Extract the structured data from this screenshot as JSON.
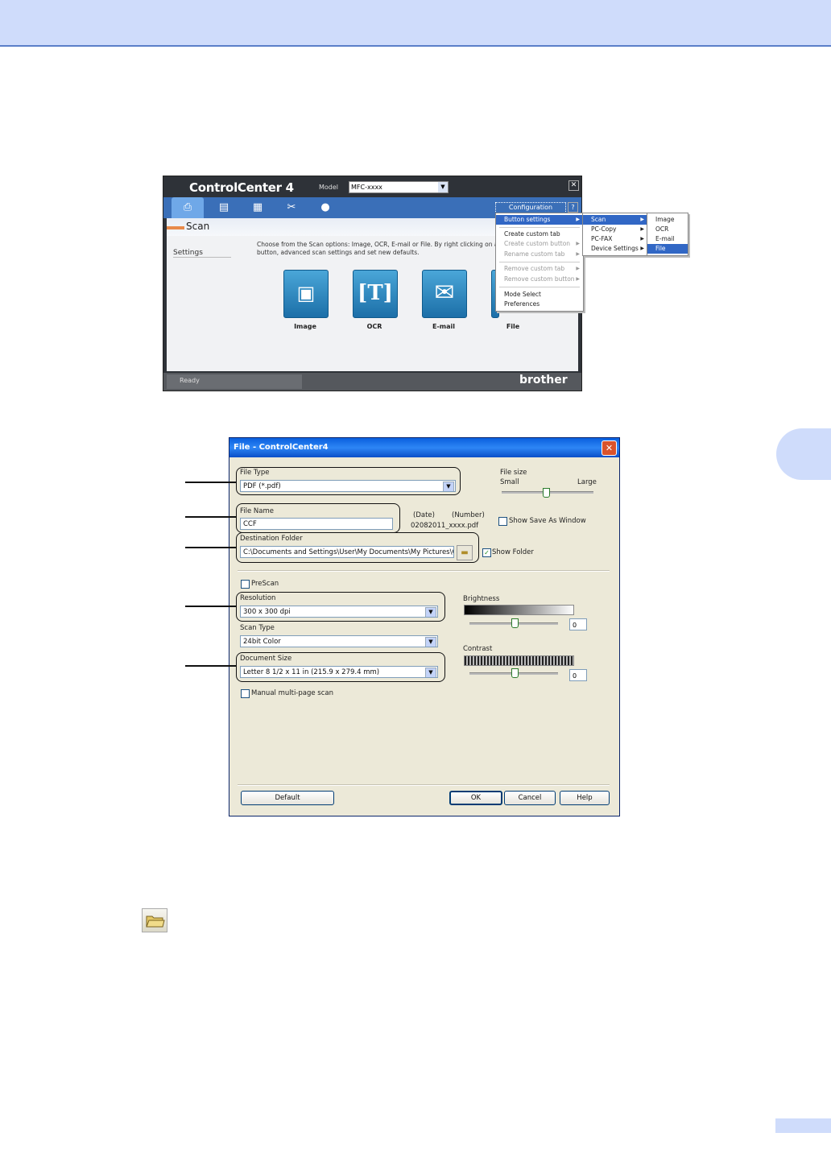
{
  "control_center": {
    "title": "ControlCenter 4",
    "model_label": "Model",
    "model_value": "MFC-xxxx",
    "tab_name": "Scan",
    "settings_label": "Settings",
    "description": "Choose from the Scan options: Image, OCR, E-mail or File. By right clicking on a button, advanced scan settings and set new defaults.",
    "configuration_label": "Configuration",
    "help_label": "?",
    "buttons": [
      {
        "label": "Image"
      },
      {
        "label": "OCR"
      },
      {
        "label": "E-mail"
      },
      {
        "label": "File"
      }
    ],
    "status": "Ready",
    "brand": "brother"
  },
  "config_menu": {
    "items": [
      "Button settings",
      "Create custom tab",
      "Create custom button",
      "Rename custom tab",
      "Remove custom tab",
      "Remove custom button",
      "Mode Select",
      "Preferences"
    ]
  },
  "button_settings_menu": {
    "items": [
      "Scan",
      "PC-Copy",
      "PC-FAX",
      "Device Settings"
    ]
  },
  "scan_menu": {
    "items": [
      "Image",
      "OCR",
      "E-mail",
      "File"
    ]
  },
  "file_dialog": {
    "title": "File - ControlCenter4",
    "file_type_label": "File Type",
    "file_type_value": "PDF (*.pdf)",
    "file_size_label": "File size",
    "file_size_small": "Small",
    "file_size_large": "Large",
    "file_name_label": "File Name",
    "file_name_value": "CCF",
    "date_label": "(Date)",
    "number_label": "(Number)",
    "file_name_sample": "02082011_xxxx.pdf",
    "show_save_as_label": "Show Save As Window",
    "destination_label": "Destination Folder",
    "destination_value": "C:\\Documents and Settings\\User\\My Documents\\My Pictures\\Co",
    "show_folder_label": "Show Folder",
    "prescan_label": "PreScan",
    "resolution_label": "Resolution",
    "resolution_value": "300 x 300 dpi",
    "scan_type_label": "Scan Type",
    "scan_type_value": "24bit Color",
    "document_size_label": "Document Size",
    "document_size_value": "Letter 8 1/2 x 11 in (215.9 x 279.4 mm)",
    "manual_multipage_label": "Manual multi-page scan",
    "brightness_label": "Brightness",
    "brightness_value": "0",
    "contrast_label": "Contrast",
    "contrast_value": "0",
    "default_button": "Default",
    "ok_button": "OK",
    "cancel_button": "Cancel",
    "help_button": "Help"
  }
}
